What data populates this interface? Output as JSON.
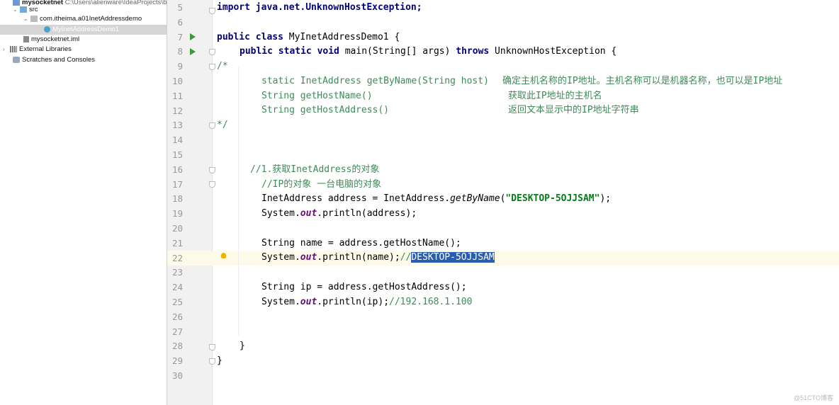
{
  "project": {
    "root": "mysocketnet",
    "root_path": "C:\\Users\\alienware\\IdeaProjects\\b",
    "items": [
      {
        "label": "src",
        "type": "folder"
      },
      {
        "label": "com.itheima.a01InetAddressdemo",
        "type": "package"
      },
      {
        "label": "MyInetAddressDemo1",
        "type": "class"
      },
      {
        "label": "mysocketnet.iml",
        "type": "file"
      },
      {
        "label": "External Libraries",
        "type": "libraries"
      },
      {
        "label": "Scratches and Consoles",
        "type": "scratches"
      }
    ]
  },
  "editor": {
    "line_numbers": [
      "5",
      "6",
      "7",
      "8",
      "9",
      "10",
      "11",
      "12",
      "13",
      "14",
      "15",
      "16",
      "17",
      "18",
      "19",
      "20",
      "21",
      "22",
      "23",
      "24",
      "25",
      "26",
      "27",
      "28",
      "29",
      "30"
    ],
    "l5": "import java.net.UnknownHostException;",
    "l7a": "public class",
    "l7b": " MyInetAddressDemo1 {",
    "l8a": "public static void",
    "l8b": " main(String[] args) ",
    "l8c": "throws",
    "l8d": " UnknownHostException {",
    "l9": "/*",
    "l10": "static InetAddress getByName(String host)",
    "l10c": "确定主机名称的IP地址。主机名称可以是机器名称，也可以是IP地址",
    "l11": "String getHostName()",
    "l11c": "获取此IP地址的主机名",
    "l12": "String getHostAddress()",
    "l12c": "返回文本显示中的IP地址字符串",
    "l13": "*/",
    "l16": "//1.获取InetAddress的对象",
    "l17": "//IP的对象 一台电脑的对象",
    "l18a": "InetAddress address = InetAddress.",
    "l18b": "getByName",
    "l18c": "(",
    "l18d": "\"DESKTOP-5OJJSAM\"",
    "l18e": ");",
    "l19a": "System.",
    "l19b": "out",
    "l19c": ".println(address);",
    "l21": "String name = address.getHostName();",
    "l22a": "System.",
    "l22b": "out",
    "l22c": ".println(name);",
    "l22d": "//",
    "l22e": "DESKTOP-5OJJSAM",
    "l24": "String ip = address.getHostAddress();",
    "l25a": "System.",
    "l25b": "out",
    "l25c": ".println(ip);",
    "l25d": "//192.168.1.100",
    "l28": "}",
    "l29": "}"
  },
  "watermark": "@51CTO博客"
}
